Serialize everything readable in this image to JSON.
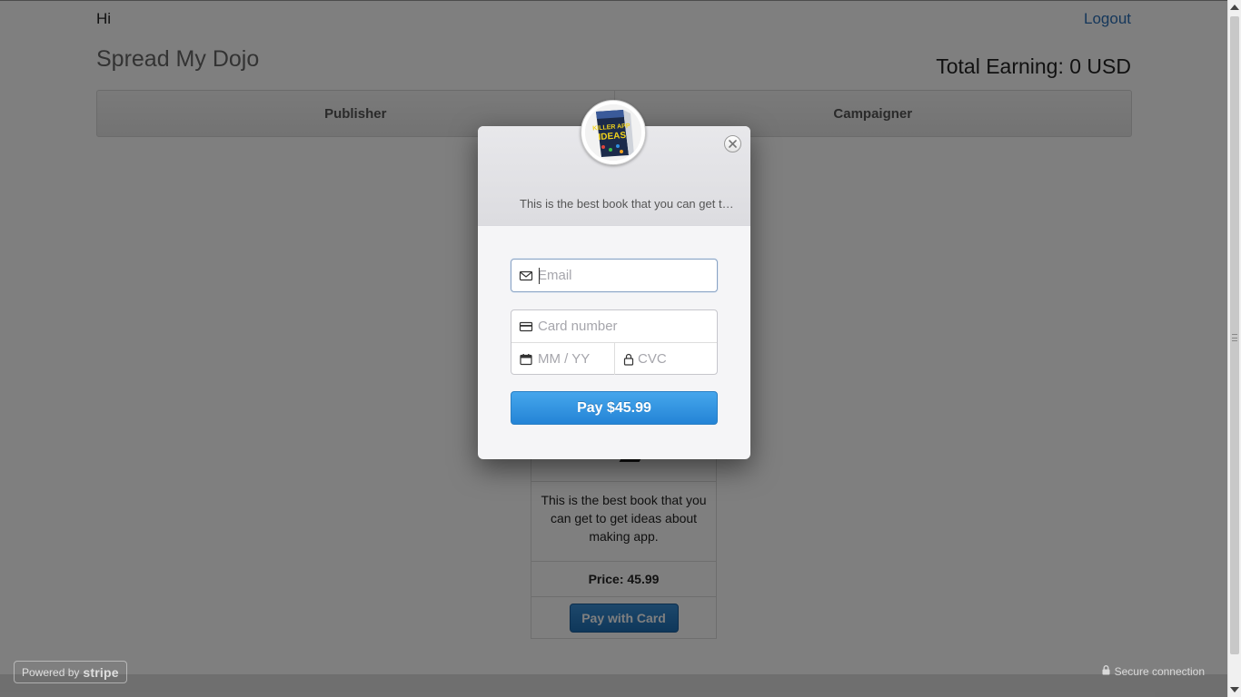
{
  "header": {
    "greeting": "Hi",
    "logout_label": "Logout",
    "brand": "Spread My Dojo",
    "total_earning": "Total Earning: 0 USD"
  },
  "nav": {
    "tabs": [
      {
        "label": "Publisher"
      },
      {
        "label": "Campaigner"
      }
    ]
  },
  "product": {
    "description": "This is the best book that you can get to get ideas about making app.",
    "price": "Price: 45.99",
    "pay_button_label": "Pay with Card"
  },
  "checkout": {
    "description": "This is the best book that you can get to get ideas about making app.",
    "logo_text": [
      "KILLER APP",
      "IDEAS"
    ],
    "email_placeholder": "Email",
    "card_number_placeholder": "Card number",
    "expiry_placeholder": "MM / YY",
    "cvc_placeholder": "CVC",
    "pay_label": "Pay $45.99"
  },
  "footer": {
    "powered_prefix": "Powered by",
    "powered_brand": "stripe",
    "secure_label": "Secure connection"
  },
  "colors": {
    "link": "#2a6fb6",
    "pay_button": "#2f8fe0",
    "product_pay_button": "#1e6fb5"
  },
  "icons": [
    "close-icon",
    "mail-icon",
    "credit-card-icon",
    "calendar-icon",
    "lock-icon"
  ]
}
